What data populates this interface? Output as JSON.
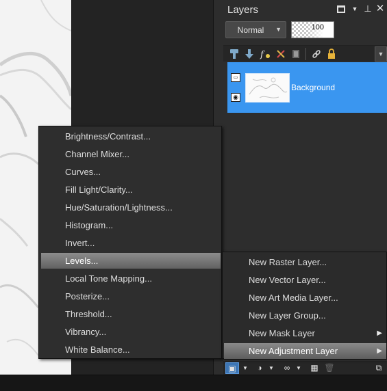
{
  "palette": {
    "title": "Layers",
    "header_icons": [
      "maximize-icon",
      "menu-arrow-icon",
      "pin-icon",
      "close-icon"
    ],
    "blend_mode": "Normal",
    "opacity": "100",
    "toolbar_icons": [
      "link-icon",
      "lock-icon"
    ],
    "layers": [
      {
        "name": "Background",
        "selected": true
      }
    ],
    "bottom_icons": [
      "new-layer-icon",
      "mask-icon",
      "adjustment-icon",
      "link-icon",
      "delete-icon",
      "expand-icon"
    ]
  },
  "adjustment_menu": {
    "items": [
      "Brightness/Contrast...",
      "Channel Mixer...",
      "Curves...",
      "Fill Light/Clarity...",
      "Hue/Saturation/Lightness...",
      "Histogram...",
      "Invert...",
      "Levels...",
      "Local Tone Mapping...",
      "Posterize...",
      "Threshold...",
      "Vibrancy...",
      "White Balance..."
    ],
    "selected_index": 7
  },
  "new_layer_menu": {
    "items": [
      {
        "label": "New Raster Layer...",
        "submenu": false
      },
      {
        "label": "New Vector Layer...",
        "submenu": false
      },
      {
        "label": "New Art Media Layer...",
        "submenu": false
      },
      {
        "label": "New Layer Group...",
        "submenu": false
      },
      {
        "label": "New Mask Layer",
        "submenu": true
      },
      {
        "label": "New Adjustment Layer",
        "submenu": true
      }
    ],
    "selected_index": 5
  },
  "colors": {
    "selected_layer": "#3a96f0",
    "menu_highlight": "#7a7a7a",
    "panel_bg": "#2d2d2d"
  }
}
